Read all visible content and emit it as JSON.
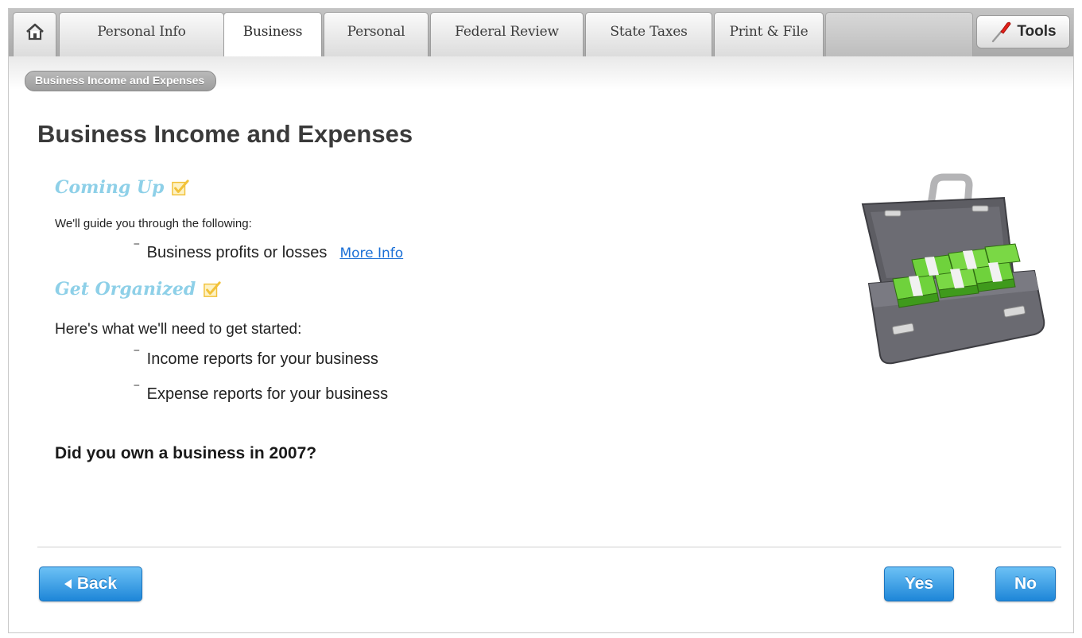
{
  "tabs": [
    {
      "id": "home",
      "label": ""
    },
    {
      "id": "personal-info",
      "label": "Personal Info"
    },
    {
      "id": "business",
      "label": "Business",
      "active": true
    },
    {
      "id": "personal",
      "label": "Personal"
    },
    {
      "id": "federal-review",
      "label": "Federal Review"
    },
    {
      "id": "state-taxes",
      "label": "State Taxes"
    },
    {
      "id": "print-file",
      "label": "Print & File"
    }
  ],
  "tools": {
    "label": "Tools"
  },
  "breadcrumb": "Business Income and Expenses",
  "page": {
    "title": "Business Income and Expenses",
    "coming_up": {
      "heading": "Coming Up",
      "intro": "We'll guide you through the following:",
      "items": [
        {
          "text": "Business profits or losses",
          "link": "More Info"
        }
      ]
    },
    "get_organized": {
      "heading": "Get Organized",
      "intro": "Here's what we'll need to get started:",
      "items": [
        "Income reports for your business",
        "Expense reports for your business"
      ]
    },
    "question": "Did you own a business in 2007?"
  },
  "buttons": {
    "back": "Back",
    "yes": "Yes",
    "no": "No"
  },
  "colors": {
    "accent_blue": "#1e86d8",
    "section_heading": "#8ed0e8",
    "link": "#1a6fd6",
    "check_yellow": "#f2c23a"
  }
}
